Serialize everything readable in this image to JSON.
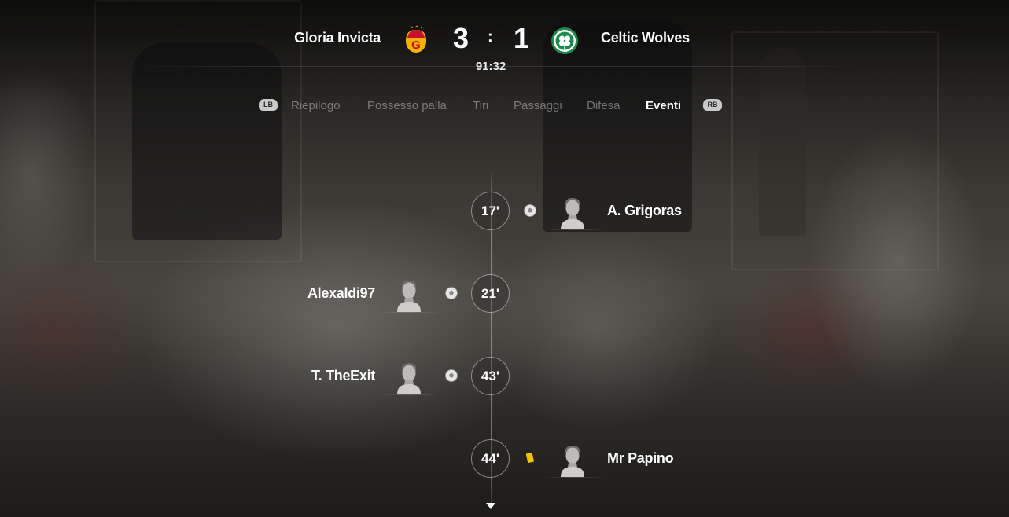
{
  "match": {
    "home_team": "Gloria Invicta",
    "away_team": "Celtic Wolves",
    "home_score": "3",
    "away_score": "1",
    "score_separator": ":",
    "clock": "91:32",
    "home_crest": "galatasaray-style-crest-icon",
    "away_crest": "celtic-style-crest-icon"
  },
  "tabs": {
    "left_bumper": "LB",
    "right_bumper": "RB",
    "items": [
      {
        "label": "Riepilogo",
        "active": false
      },
      {
        "label": "Possesso palla",
        "active": false
      },
      {
        "label": "Tiri",
        "active": false
      },
      {
        "label": "Passaggi",
        "active": false
      },
      {
        "label": "Difesa",
        "active": false
      },
      {
        "label": "Eventi",
        "active": true
      }
    ]
  },
  "events": [
    {
      "minute": "17'",
      "side": "away",
      "type": "goal",
      "icon": "soccer-ball-icon",
      "player": "A. Grigoras"
    },
    {
      "minute": "21'",
      "side": "home",
      "type": "goal",
      "icon": "soccer-ball-icon",
      "player": "Alexaldi97"
    },
    {
      "minute": "43'",
      "side": "home",
      "type": "goal",
      "icon": "soccer-ball-icon",
      "player": "T. TheExit"
    },
    {
      "minute": "44'",
      "side": "away",
      "type": "yellow-card",
      "icon": "yellow-card-icon",
      "player": "Mr Papino"
    }
  ],
  "colors": {
    "yellow_card": "#f2c200",
    "active_tab": "#ffffff",
    "inactive_tab": "#8a8784"
  },
  "scroll_indicator": "chevron-down-icon"
}
